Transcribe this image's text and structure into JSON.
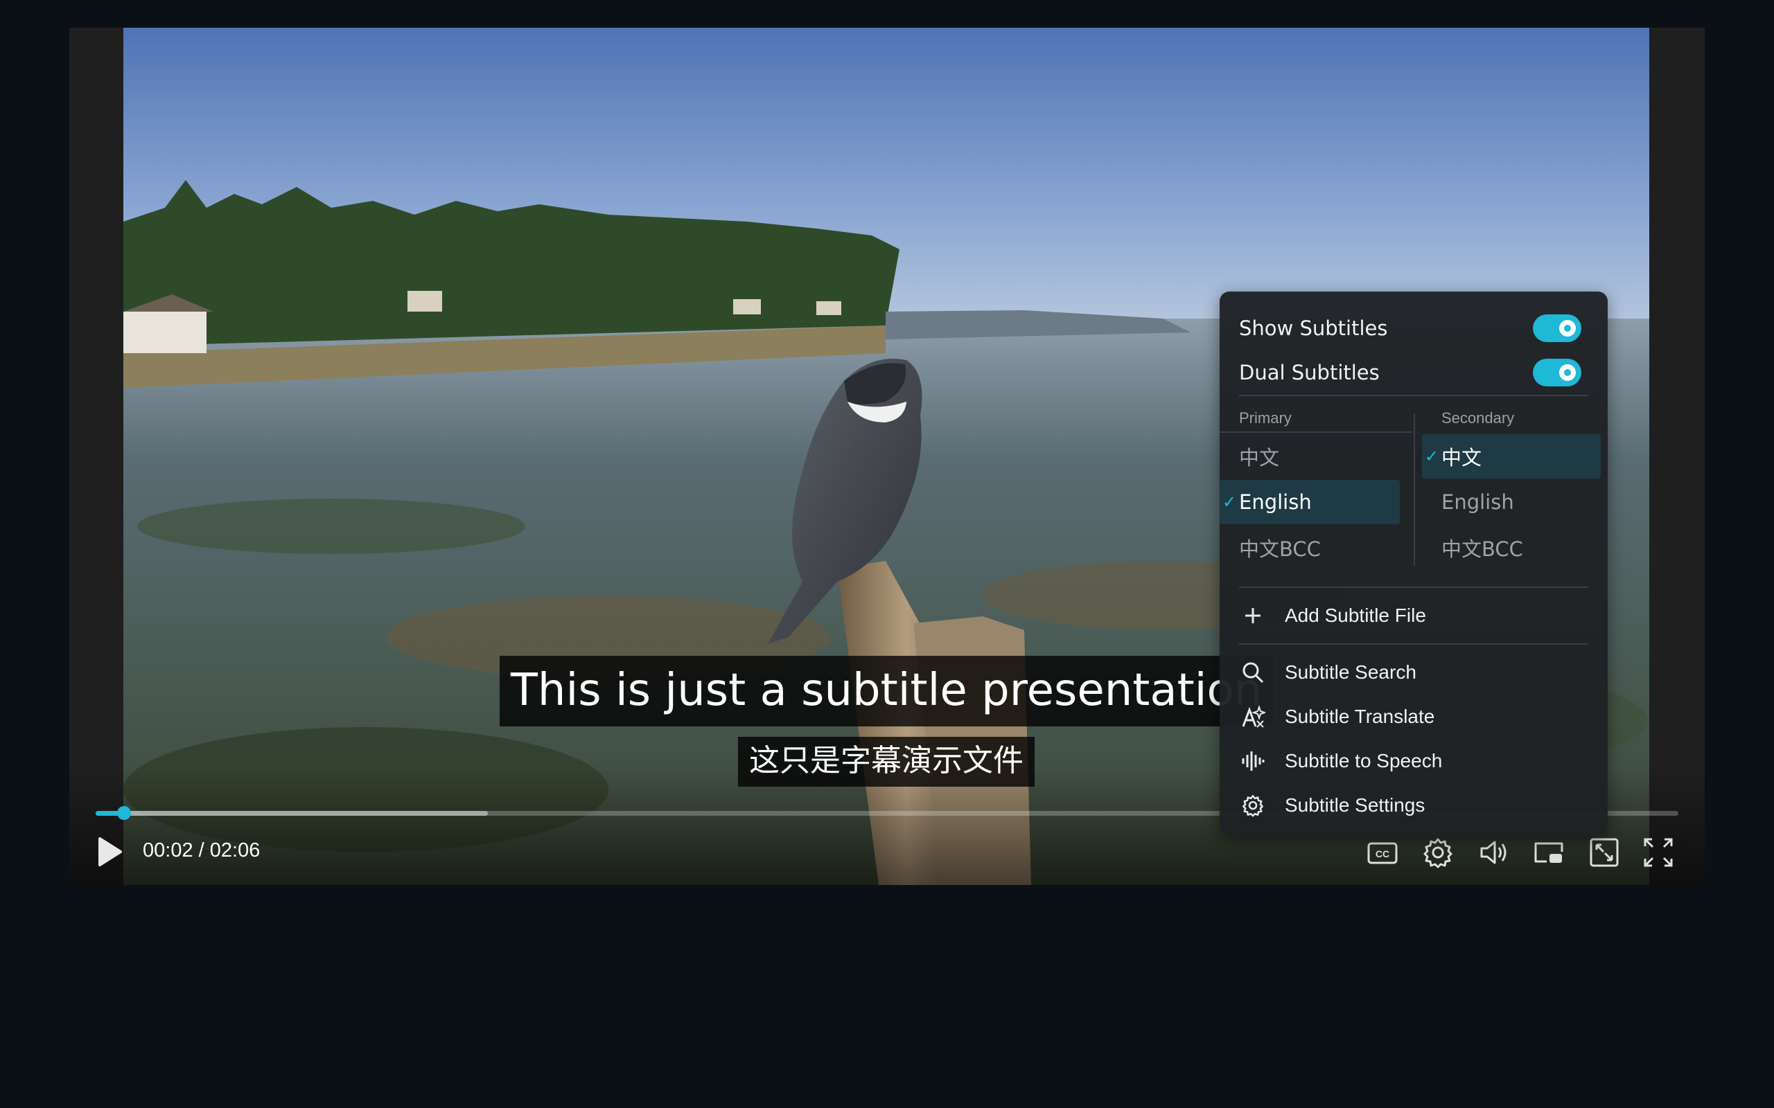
{
  "player": {
    "current_time": "00:02",
    "separator": "/",
    "duration": "02:06",
    "progress_fraction": 0.018,
    "buffered_fraction": 0.248
  },
  "subtitles": {
    "primary_text": "This is just a subtitle presentation",
    "secondary_text": "这只是字幕演示文件"
  },
  "menu": {
    "show_subtitles_label": "Show Subtitles",
    "show_subtitles_on": true,
    "dual_subtitles_label": "Dual Subtitles",
    "dual_subtitles_on": true,
    "primary_header": "Primary",
    "secondary_header": "Secondary",
    "primary_options": [
      "中文",
      "English",
      "中文BCC"
    ],
    "primary_selected": "English",
    "secondary_options": [
      "中文",
      "English",
      "中文BCC"
    ],
    "secondary_selected": "中文",
    "check_mark": "✓",
    "add_file_label": "Add Subtitle File",
    "actions": [
      {
        "label": "Subtitle Search",
        "icon": "search-icon"
      },
      {
        "label": "Subtitle Translate",
        "icon": "translate-icon"
      },
      {
        "label": "Subtitle to Speech",
        "icon": "waveform-icon"
      },
      {
        "label": "Subtitle Settings",
        "icon": "gear-icon"
      }
    ]
  },
  "controls": {
    "icons": [
      "play-icon",
      "cc-icon",
      "settings-icon",
      "volume-icon",
      "pip-icon",
      "resize-icon",
      "fullscreen-icon"
    ]
  },
  "colors": {
    "accent": "#1fb8d6",
    "page_background": "#0b0f16",
    "menu_background": "#1e2124",
    "selected_row": "#1e3a44"
  }
}
